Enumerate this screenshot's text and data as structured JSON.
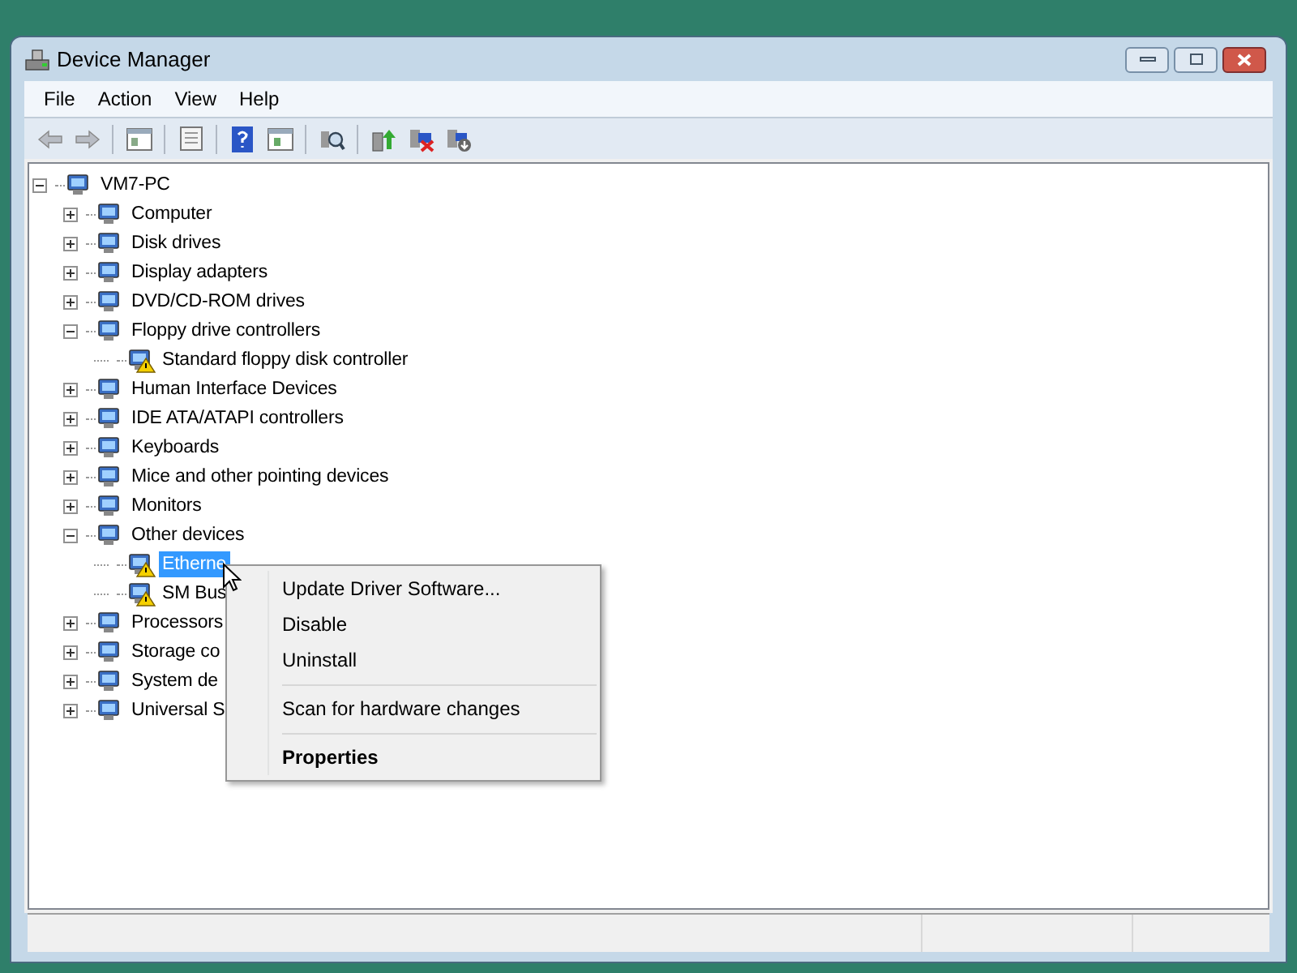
{
  "window": {
    "title": "Device Manager"
  },
  "menu_bar": [
    "File",
    "Action",
    "View",
    "Help"
  ],
  "tree": [
    {
      "label": "VM7-PC",
      "expanded": true,
      "selected": false,
      "warning": false,
      "children": [
        {
          "label": "Computer",
          "expanded": false,
          "selected": false,
          "warning": false
        },
        {
          "label": "Disk drives",
          "expanded": false,
          "selected": false,
          "warning": false
        },
        {
          "label": "Display adapters",
          "expanded": false,
          "selected": false,
          "warning": false
        },
        {
          "label": "DVD/CD-ROM drives",
          "expanded": false,
          "selected": false,
          "warning": false
        },
        {
          "label": "Floppy drive controllers",
          "expanded": true,
          "selected": false,
          "warning": false,
          "children": [
            {
              "label": "Standard floppy disk controller",
              "selected": false,
              "warning": true
            }
          ]
        },
        {
          "label": "Human Interface Devices",
          "expanded": false,
          "selected": false,
          "warning": false
        },
        {
          "label": "IDE ATA/ATAPI controllers",
          "expanded": false,
          "selected": false,
          "warning": false
        },
        {
          "label": "Keyboards",
          "expanded": false,
          "selected": false,
          "warning": false
        },
        {
          "label": "Mice and other pointing devices",
          "expanded": false,
          "selected": false,
          "warning": false
        },
        {
          "label": "Monitors",
          "expanded": false,
          "selected": false,
          "warning": false
        },
        {
          "label": "Other devices",
          "expanded": true,
          "selected": false,
          "warning": false,
          "children": [
            {
              "label": "Etherne",
              "selected": true,
              "warning": true
            },
            {
              "label": "SM Bus",
              "selected": false,
              "warning": true
            }
          ]
        },
        {
          "label": "Processors",
          "expanded": false,
          "selected": false,
          "warning": false
        },
        {
          "label": "Storage co",
          "expanded": false,
          "selected": false,
          "warning": false
        },
        {
          "label": "System de",
          "expanded": false,
          "selected": false,
          "warning": false
        },
        {
          "label": "Universal S",
          "expanded": false,
          "selected": false,
          "warning": false
        }
      ]
    }
  ],
  "context_menu": [
    {
      "kind": "item",
      "label": "Update Driver Software...",
      "default": false
    },
    {
      "kind": "item",
      "label": "Disable",
      "default": false
    },
    {
      "kind": "item",
      "label": "Uninstall",
      "default": false
    },
    {
      "kind": "separator"
    },
    {
      "kind": "item",
      "label": "Scan for hardware changes",
      "default": false
    },
    {
      "kind": "separator"
    },
    {
      "kind": "item",
      "label": "Properties",
      "default": true
    }
  ]
}
